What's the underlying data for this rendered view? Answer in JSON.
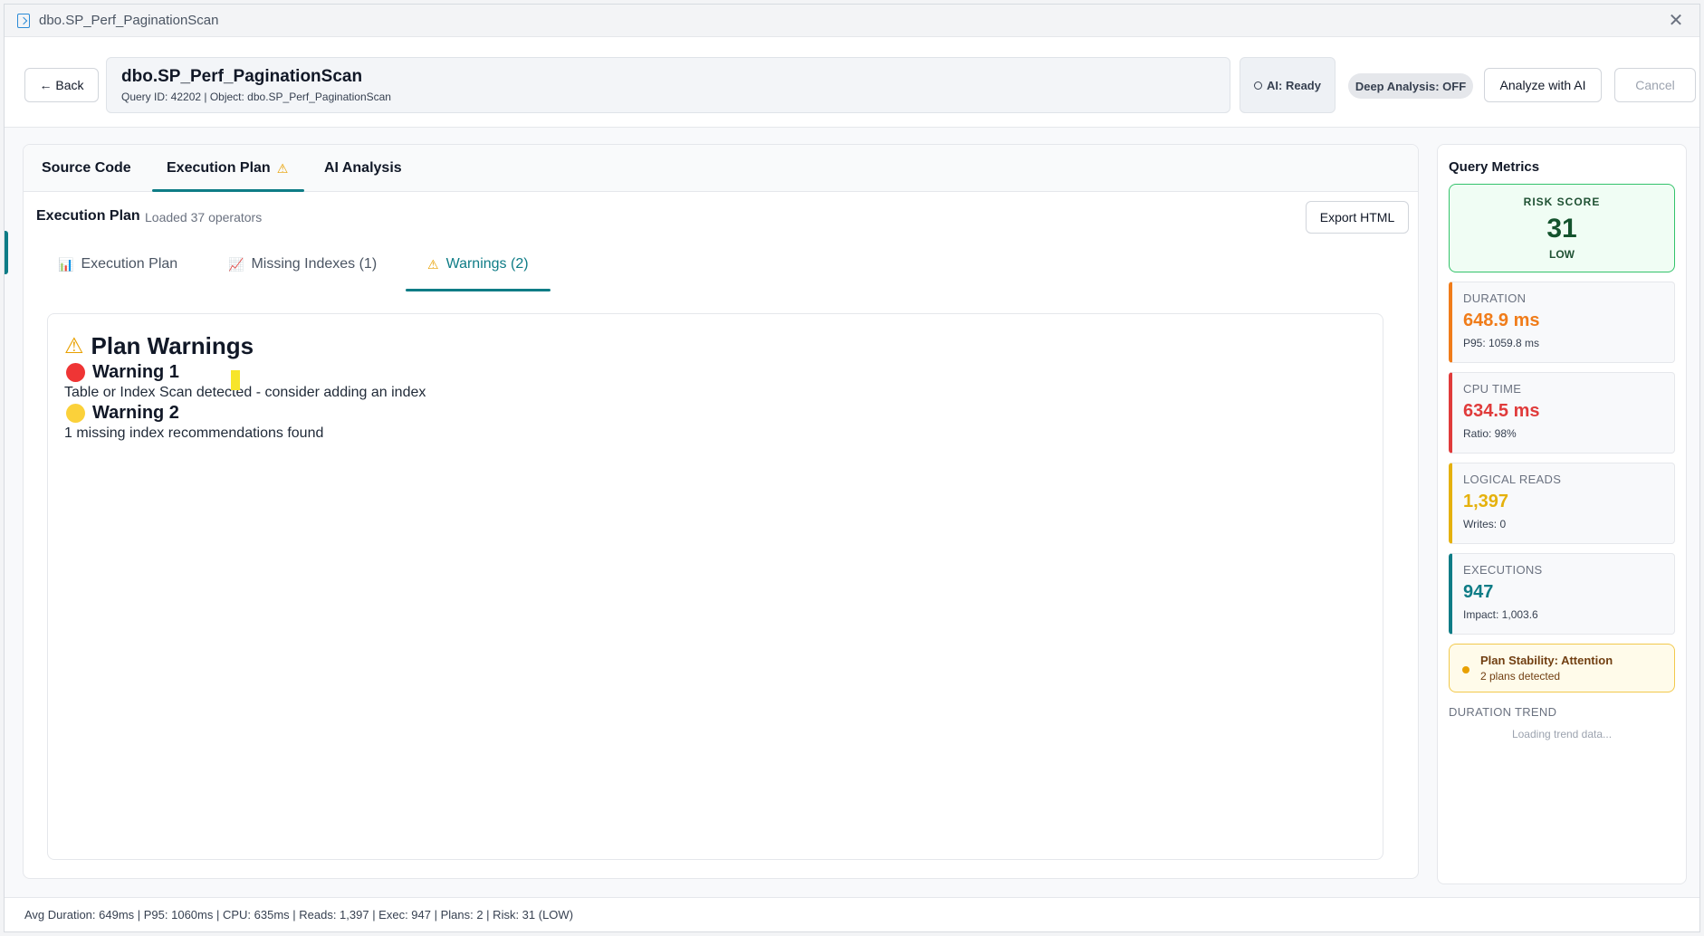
{
  "window": {
    "title": "dbo.SP_Perf_PaginationScan",
    "close_symbol": "✕"
  },
  "header": {
    "back_label": "← Back",
    "query_name": "dbo.SP_Perf_PaginationScan",
    "query_sub": "Query ID: 42202 | Object: dbo.SP_Perf_PaginationScan",
    "ai_status": "AI: Ready",
    "deep_analysis": "Deep Analysis: OFF",
    "analyze_label": "Analyze with AI",
    "cancel_label": "Cancel"
  },
  "tabs": [
    {
      "label": "Source Code",
      "active": false
    },
    {
      "label": "Execution Plan",
      "active": true,
      "icon": "warning-icon"
    },
    {
      "label": "AI Analysis",
      "active": false
    }
  ],
  "plan": {
    "title": "Execution Plan",
    "status": "Loaded 37 operators",
    "export_label": "Export HTML",
    "sub_tabs": [
      {
        "label": "Execution Plan",
        "icon": "chart-icon",
        "active": false
      },
      {
        "label": "Missing Indexes (1)",
        "icon": "trend-icon",
        "active": false
      },
      {
        "label": "Warnings (2)",
        "icon": "warning-icon",
        "active": true
      }
    ],
    "warnings_title": "Plan Warnings",
    "warnings": [
      {
        "title": "Warning 1",
        "text": "Table or Index Scan detected - consider adding an index",
        "severity": "red"
      },
      {
        "title": "Warning 2",
        "text": "1 missing index recommendations found",
        "severity": "yellow"
      }
    ]
  },
  "metrics": {
    "title": "Query Metrics",
    "risk": {
      "label": "RISK SCORE",
      "value": "31",
      "level": "LOW"
    },
    "cards": [
      {
        "label": "DURATION",
        "value": "648.9 ms",
        "sub": "P95: 1059.8 ms",
        "color": "#f07c1a"
      },
      {
        "label": "CPU TIME",
        "value": "634.5 ms",
        "sub": "Ratio: 98%",
        "color": "#e03b3b"
      },
      {
        "label": "LOGICAL READS",
        "value": "1,397",
        "sub": "Writes: 0",
        "color": "#e5b10c"
      },
      {
        "label": "EXECUTIONS",
        "value": "947",
        "sub": "Impact: 1,003.6",
        "color": "#0e7c86"
      }
    ],
    "stability": {
      "title": "Plan Stability: Attention",
      "sub": "2 plans detected"
    },
    "trend_label": "DURATION TREND",
    "trend_loading": "Loading trend data..."
  },
  "statusbar": "Avg Duration: 649ms | P95: 1060ms | CPU: 635ms | Reads: 1,397 | Exec: 947 | Plans: 2 | Risk: 31 (LOW)"
}
